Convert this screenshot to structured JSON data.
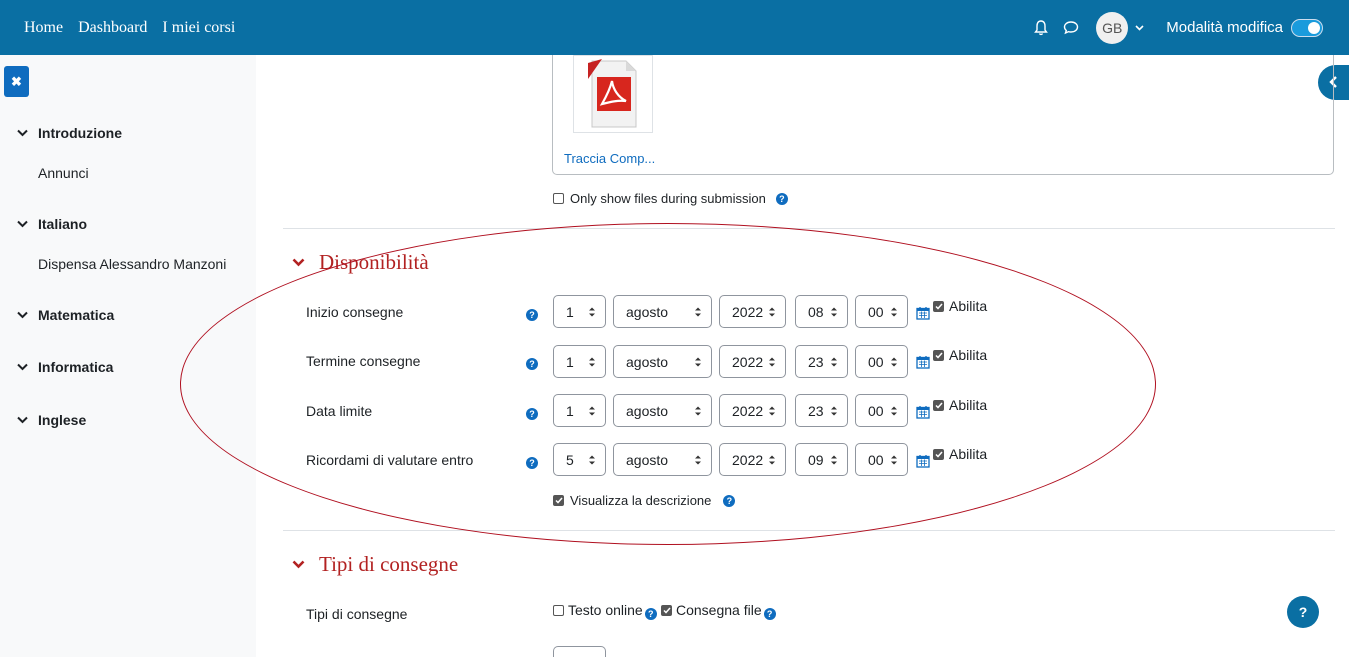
{
  "nav": {
    "links": [
      "Home",
      "Dashboard",
      "I miei corsi"
    ],
    "avatar_initials": "GB",
    "edit_mode_label": "Modalità modifica",
    "edit_mode_on": true,
    "icons": [
      "bell-icon",
      "chat-icon"
    ]
  },
  "sidebar": {
    "sections": [
      {
        "title": "Introduzione",
        "items": [
          "Annunci"
        ]
      },
      {
        "title": "Italiano",
        "items": [
          "Dispensa Alessandro Manzoni"
        ]
      },
      {
        "title": "Matematica",
        "items": []
      },
      {
        "title": "Informatica",
        "items": []
      },
      {
        "title": "Inglese",
        "items": []
      }
    ]
  },
  "files": {
    "file_name": "Traccia Comp...",
    "only_show_label": "Only show files during submission"
  },
  "availability": {
    "title": "Disponibilità",
    "enable_label": "Abilita",
    "rows": [
      {
        "label": "Inizio consegne",
        "day": "1",
        "month": "agosto",
        "year": "2022",
        "hour": "08",
        "minute": "00"
      },
      {
        "label": "Termine consegne",
        "day": "1",
        "month": "agosto",
        "year": "2022",
        "hour": "23",
        "minute": "00"
      },
      {
        "label": "Data limite",
        "day": "1",
        "month": "agosto",
        "year": "2022",
        "hour": "23",
        "minute": "00"
      },
      {
        "label": "Ricordami di valutare entro",
        "day": "5",
        "month": "agosto",
        "year": "2022",
        "hour": "09",
        "minute": "00"
      }
    ],
    "show_description_label": "Visualizza la descrizione"
  },
  "submission_types": {
    "title": "Tipi di consegne",
    "label": "Tipi di consegne",
    "online_text_label": "Testo online",
    "file_label": "Consegna file"
  },
  "colors": {
    "navbar": "#0a6fa3",
    "section_title": "#b22222",
    "link": "#0f6cbf",
    "annotation": "#b01020"
  }
}
